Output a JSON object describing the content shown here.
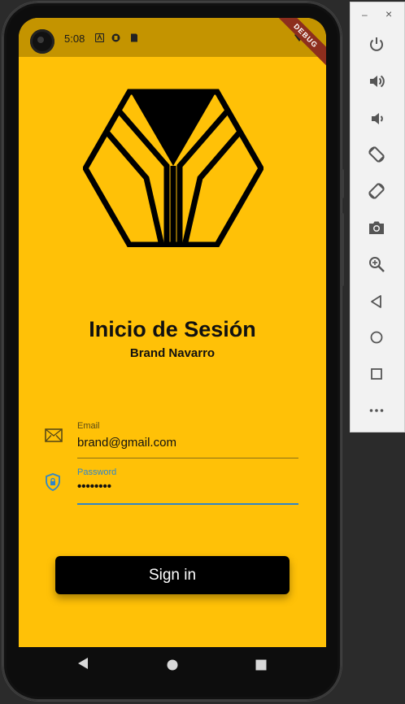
{
  "status_bar": {
    "time": "5:08",
    "debug_banner": "DEBUG"
  },
  "login": {
    "title": "Inicio de Sesión",
    "subtitle": "Brand Navarro",
    "email": {
      "label": "Email",
      "value": "brand@gmail.com"
    },
    "password": {
      "label": "Password",
      "value": "••••••••"
    },
    "signin_label": "Sign in"
  },
  "colors": {
    "background": "#ffc107",
    "status_bar": "#c49400",
    "focus_accent": "#2f86c9",
    "button": "#000000",
    "button_text": "#ffffff"
  },
  "emulator_panel": {
    "window_controls": [
      "minimize",
      "close"
    ],
    "tools": [
      "power-icon",
      "volume-up-icon",
      "volume-down-icon",
      "rotate-left-icon",
      "rotate-right-icon",
      "camera-icon",
      "zoom-icon",
      "back-icon",
      "home-icon",
      "overview-icon",
      "more-icon"
    ]
  },
  "nav_bar": {
    "buttons": [
      "back-icon",
      "home-icon",
      "recents-icon"
    ]
  }
}
